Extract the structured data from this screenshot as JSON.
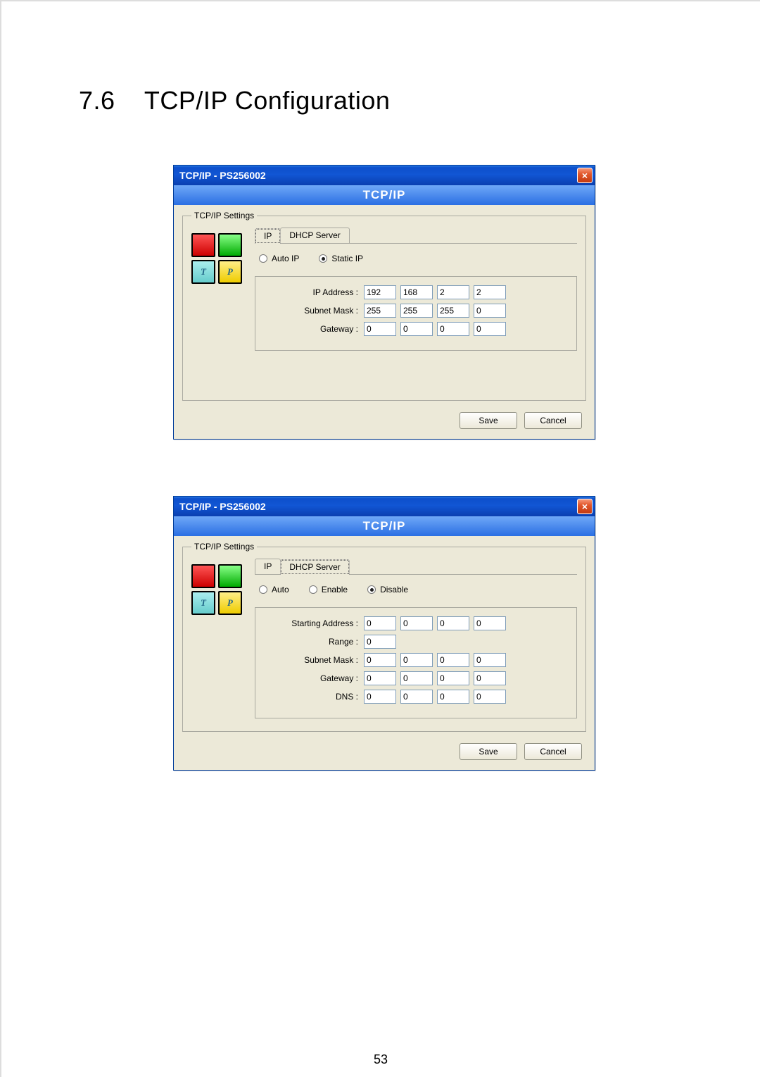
{
  "heading": "7.6    TCP/IP Configuration",
  "pageNumber": "53",
  "dialog1": {
    "title": "TCP/IP - PS256002",
    "banner": "TCP/IP",
    "fieldsetLegend": "TCP/IP Settings",
    "tabs": {
      "ip": "IP",
      "dhcp": "DHCP Server"
    },
    "radios": {
      "auto": "Auto IP",
      "static": "Static IP"
    },
    "labels": {
      "ip": "IP Address :",
      "mask": "Subnet Mask :",
      "gw": "Gateway :"
    },
    "values": {
      "ip": [
        "192",
        "168",
        "2",
        "2"
      ],
      "mask": [
        "255",
        "255",
        "255",
        "0"
      ],
      "gw": [
        "0",
        "0",
        "0",
        "0"
      ]
    },
    "buttons": {
      "save": "Save",
      "cancel": "Cancel"
    }
  },
  "dialog2": {
    "title": "TCP/IP - PS256002",
    "banner": "TCP/IP",
    "fieldsetLegend": "TCP/IP Settings",
    "tabs": {
      "ip": "IP",
      "dhcp": "DHCP Server"
    },
    "radios": {
      "auto": "Auto",
      "enable": "Enable",
      "disable": "Disable"
    },
    "labels": {
      "start": "Starting Address :",
      "range": "Range :",
      "mask": "Subnet Mask :",
      "gw": "Gateway :",
      "dns": "DNS :"
    },
    "values": {
      "start": [
        "0",
        "0",
        "0",
        "0"
      ],
      "range": [
        "0"
      ],
      "mask": [
        "0",
        "0",
        "0",
        "0"
      ],
      "gw": [
        "0",
        "0",
        "0",
        "0"
      ],
      "dns": [
        "0",
        "0",
        "0",
        "0"
      ]
    },
    "buttons": {
      "save": "Save",
      "cancel": "Cancel"
    }
  },
  "icons": {
    "close": "×",
    "iconT": "T",
    "iconP": "P"
  }
}
